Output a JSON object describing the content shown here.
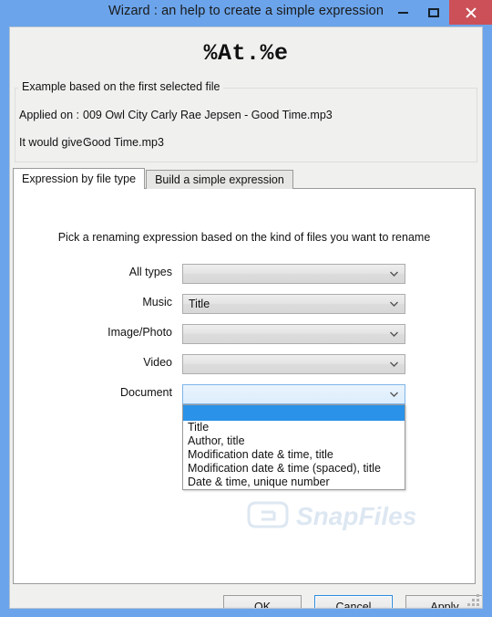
{
  "window": {
    "title": "Wizard : an help to create a simple expression",
    "controls": {
      "minimize": "minimize-icon",
      "maximize": "maximize-icon",
      "close": "close-icon"
    },
    "colors": {
      "titlebar": "#6ba4ea",
      "close_button": "#cb5058",
      "client": "#f0f0ef",
      "selection": "#2a92e8",
      "focus_border": "#2a8adc"
    }
  },
  "expression": {
    "value": "%At.%e"
  },
  "example_group": {
    "legend": "Example based on the first selected file",
    "rows": [
      {
        "label": "Applied on :",
        "value": "009 Owl City  Carly Rae Jepsen - Good Time.mp3"
      },
      {
        "label": "It would give :",
        "value": "Good Time.mp3"
      }
    ]
  },
  "tabs": [
    {
      "label": "Expression by file type",
      "active": true
    },
    {
      "label": "Build a simple expression",
      "active": false
    }
  ],
  "panel": {
    "instruction": "Pick a renaming expression based on the kind of files you want to rename",
    "combos": [
      {
        "label": "All types",
        "value": "",
        "open": false
      },
      {
        "label": "Music",
        "value": "Title",
        "open": false
      },
      {
        "label": "Image/Photo",
        "value": "",
        "open": false
      },
      {
        "label": "Video",
        "value": "",
        "open": false
      },
      {
        "label": "Document",
        "value": "",
        "open": true
      }
    ],
    "document_dropdown": {
      "selected_index": 0,
      "options": [
        "",
        "Title",
        "Author, title",
        "Modification date & time, title",
        "Modification date & time (spaced), title",
        "Date & time, unique number"
      ]
    }
  },
  "watermark": {
    "text": "SnapFiles"
  },
  "footer": {
    "buttons": [
      {
        "label": "OK",
        "focused": false
      },
      {
        "label": "Cancel",
        "focused": true
      },
      {
        "label": "Apply",
        "focused": false
      }
    ]
  }
}
